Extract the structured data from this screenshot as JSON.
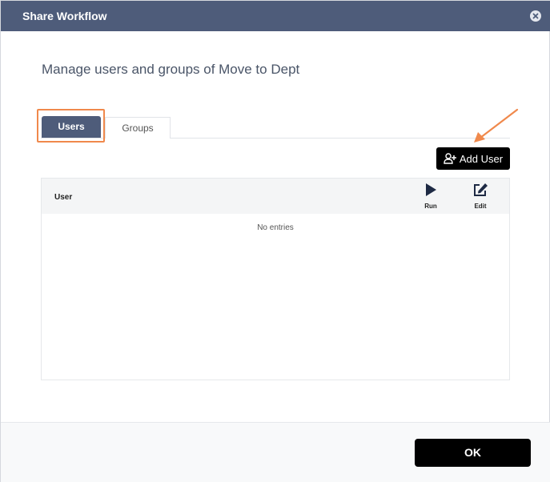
{
  "dialog": {
    "title": "Share Workflow",
    "heading": "Manage users and groups of Move to Dept"
  },
  "tabs": [
    {
      "label": "Users",
      "active": true
    },
    {
      "label": "Groups",
      "active": false
    }
  ],
  "toolbar": {
    "add_user_label": "Add User"
  },
  "table": {
    "columns": {
      "user": "User",
      "run": "Run",
      "edit": "Edit"
    },
    "empty_text": "No entries"
  },
  "footer": {
    "ok_label": "OK"
  },
  "colors": {
    "header_bg": "#4e5c7a",
    "highlight": "#f0894c",
    "button_bg": "#000000"
  },
  "icons": [
    "close-icon",
    "add-user-icon",
    "play-icon",
    "edit-icon",
    "annotation-arrow-icon"
  ]
}
